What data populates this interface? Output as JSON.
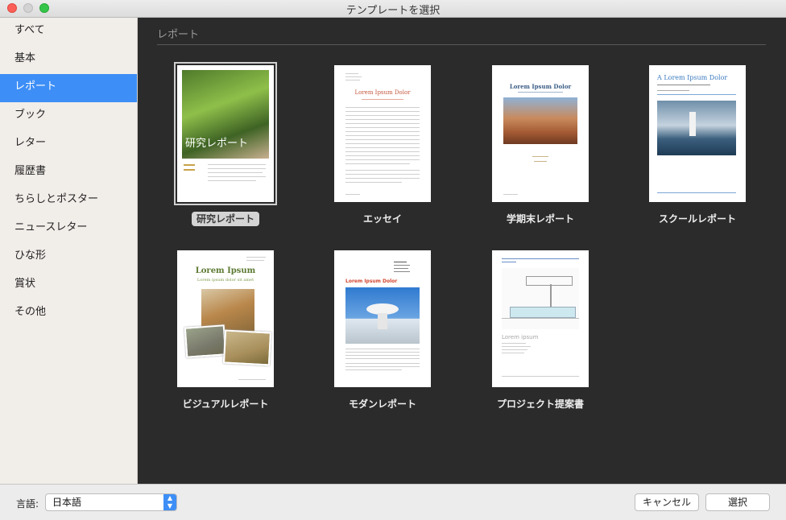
{
  "window": {
    "title": "テンプレートを選択"
  },
  "sidebar": {
    "items": [
      {
        "label": "すべて"
      },
      {
        "label": "基本"
      },
      {
        "label": "レポート",
        "selected": true
      },
      {
        "label": "ブック"
      },
      {
        "label": "レター"
      },
      {
        "label": "履歴書"
      },
      {
        "label": "ちらしとポスター"
      },
      {
        "label": "ニュースレター"
      },
      {
        "label": "ひな形"
      },
      {
        "label": "賞状"
      },
      {
        "label": "その他"
      }
    ]
  },
  "main": {
    "section_title": "レポート",
    "templates": [
      {
        "name": "研究レポート",
        "selected": true,
        "cover_text": "研究レポート"
      },
      {
        "name": "エッセイ",
        "heading": "Lorem Ipsum Dolor"
      },
      {
        "name": "学期末レポート",
        "heading": "Lorem Ipsum Dolor"
      },
      {
        "name": "スクールレポート",
        "heading": "A Lorem Ipsum Dolor"
      },
      {
        "name": "ビジュアルレポート",
        "heading": "Lorem Ipsum",
        "subheading": "Lorem ipsum dolor sit amet"
      },
      {
        "name": "モダンレポート",
        "heading": "Lorem Ipsum Dolor"
      },
      {
        "name": "プロジェクト提案書",
        "heading": "Lorem ipsum"
      }
    ]
  },
  "footer": {
    "language_label": "言語:",
    "language_value": "日本語",
    "cancel_label": "キャンセル",
    "select_label": "選択"
  },
  "colors": {
    "accent": "#3d8ef6",
    "content_bg": "#2b2b2b",
    "sidebar_bg": "#f1ede9"
  }
}
